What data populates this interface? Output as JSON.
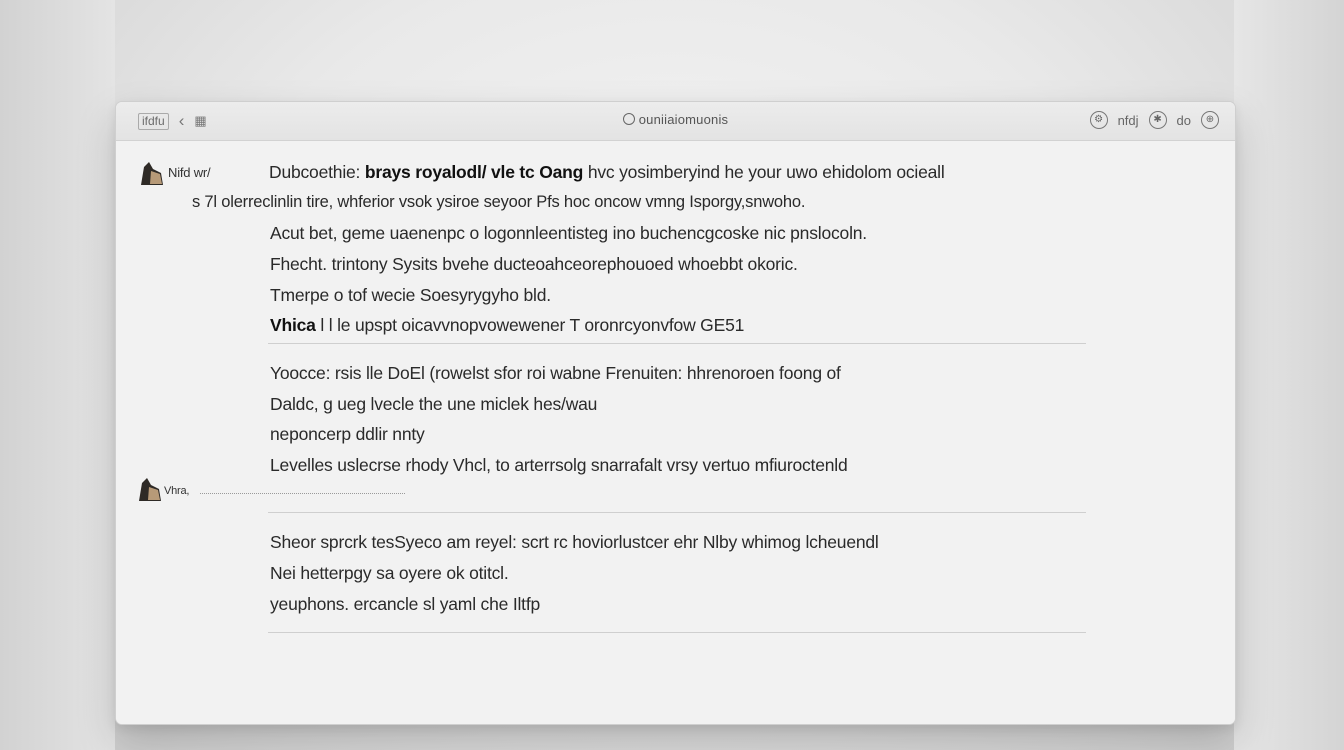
{
  "titlebar": {
    "left_label": "ifdfu",
    "back_icon": "chevron-left-icon",
    "grid_icon": "grid-icon",
    "title": "ouniiaiomuonis",
    "right_items": [
      "nfdj",
      "do"
    ],
    "right_icon_1": "settings-icon",
    "right_icon_2": "globe-icon"
  },
  "messages": [
    {
      "sender": "Nifd wr/",
      "lines": [
        {
          "pre": "Dubcoethie: ",
          "bold": "brays royalodl/ vle tc Oang",
          "post": " hvc yosimberyind he your uwo ehidolom ocieall"
        },
        {
          "text": "s 7l olerreclinlin tire, whferior vsok ysiroe seyoor Pfs hoc oncow vmng Isporgy,snwoho."
        },
        {
          "text": "Acut bet, geme uaenenpc o logonnleentisteg ino buchencgcoske nic pnslocoln."
        },
        {
          "text": "Fhecht. trintony Sysits bvehe ducteoahceorephouoed whoebbt okoric."
        },
        {
          "text": "Tmerpe o tof wecie Soesyrygyho bld."
        },
        {
          "pre": "",
          "bold": "Vhica",
          "post": " l l le upspt oicavvnopvowewener T oronrcyonvfow GE51"
        }
      ]
    },
    {
      "lines": [
        {
          "text": "Yoocce: rsis lle DoEl (rowelst sfor roi wabne Frenuiten: hhrenoroen foong of"
        },
        {
          "text": "Daldc, g ueg lvecle the une miclek hes/wau"
        },
        {
          "text": "neponcerp ddlir nnty"
        },
        {
          "text": "Levelles uslecrse rhody Vhcl, to arterrsolg snarrafalt vrsy vertuo mfiuroctenld"
        }
      ]
    },
    {
      "sender": "Vhra,",
      "lines": [
        {
          "text": "Sheor sprcrk tesSyeco am reyel: scrt rc hoviorlustcer ehr Nlby whimog lcheuendl"
        },
        {
          "text": "Nei hetterpgy sa oyere ok otitcl."
        },
        {
          "text": "yeuphons. ercancle sl yaml che Iltfp"
        }
      ]
    }
  ]
}
